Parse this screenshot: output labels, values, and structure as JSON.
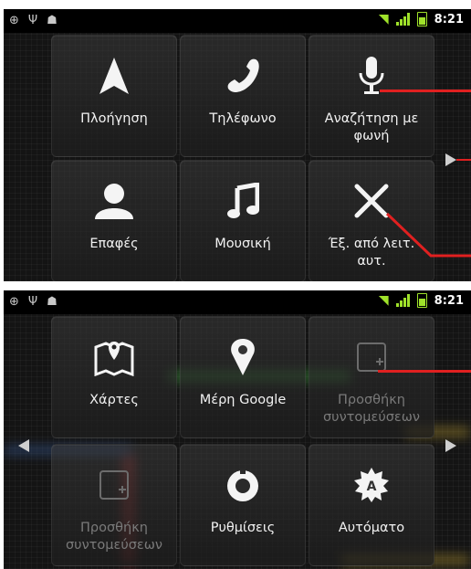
{
  "status_bar": {
    "time": "8:21"
  },
  "screen1": {
    "tiles": [
      {
        "label": "Πλοήγηση",
        "icon": "navigation-arrow-icon"
      },
      {
        "label": "Τηλέφωνο",
        "icon": "phone-handset-icon"
      },
      {
        "label": "Αναζήτηση με φωνή",
        "icon": "microphone-icon"
      },
      {
        "label": "Επαφές",
        "icon": "contact-person-icon"
      },
      {
        "label": "Μουσική",
        "icon": "music-note-icon"
      },
      {
        "label": "Έξ. από λειτ. αυτ.",
        "icon": "close-x-icon"
      }
    ]
  },
  "screen2": {
    "tiles": [
      {
        "label": "Χάρτες",
        "icon": "map-pin-book-icon"
      },
      {
        "label": "Μέρη Google",
        "icon": "place-pin-icon"
      },
      {
        "label": "Προσθήκη συντομεύσεων",
        "icon": "add-shortcut-icon"
      },
      {
        "label": "Προσθήκη συντομεύσεων",
        "icon": "add-shortcut-icon"
      },
      {
        "label": "Ρυθμίσεις",
        "icon": "settings-dial-icon"
      },
      {
        "label": "Αυτόματο",
        "icon": "auto-brightness-icon"
      }
    ]
  },
  "colors": {
    "accent_green": "#9fe22a",
    "callout_red": "#e02020"
  }
}
